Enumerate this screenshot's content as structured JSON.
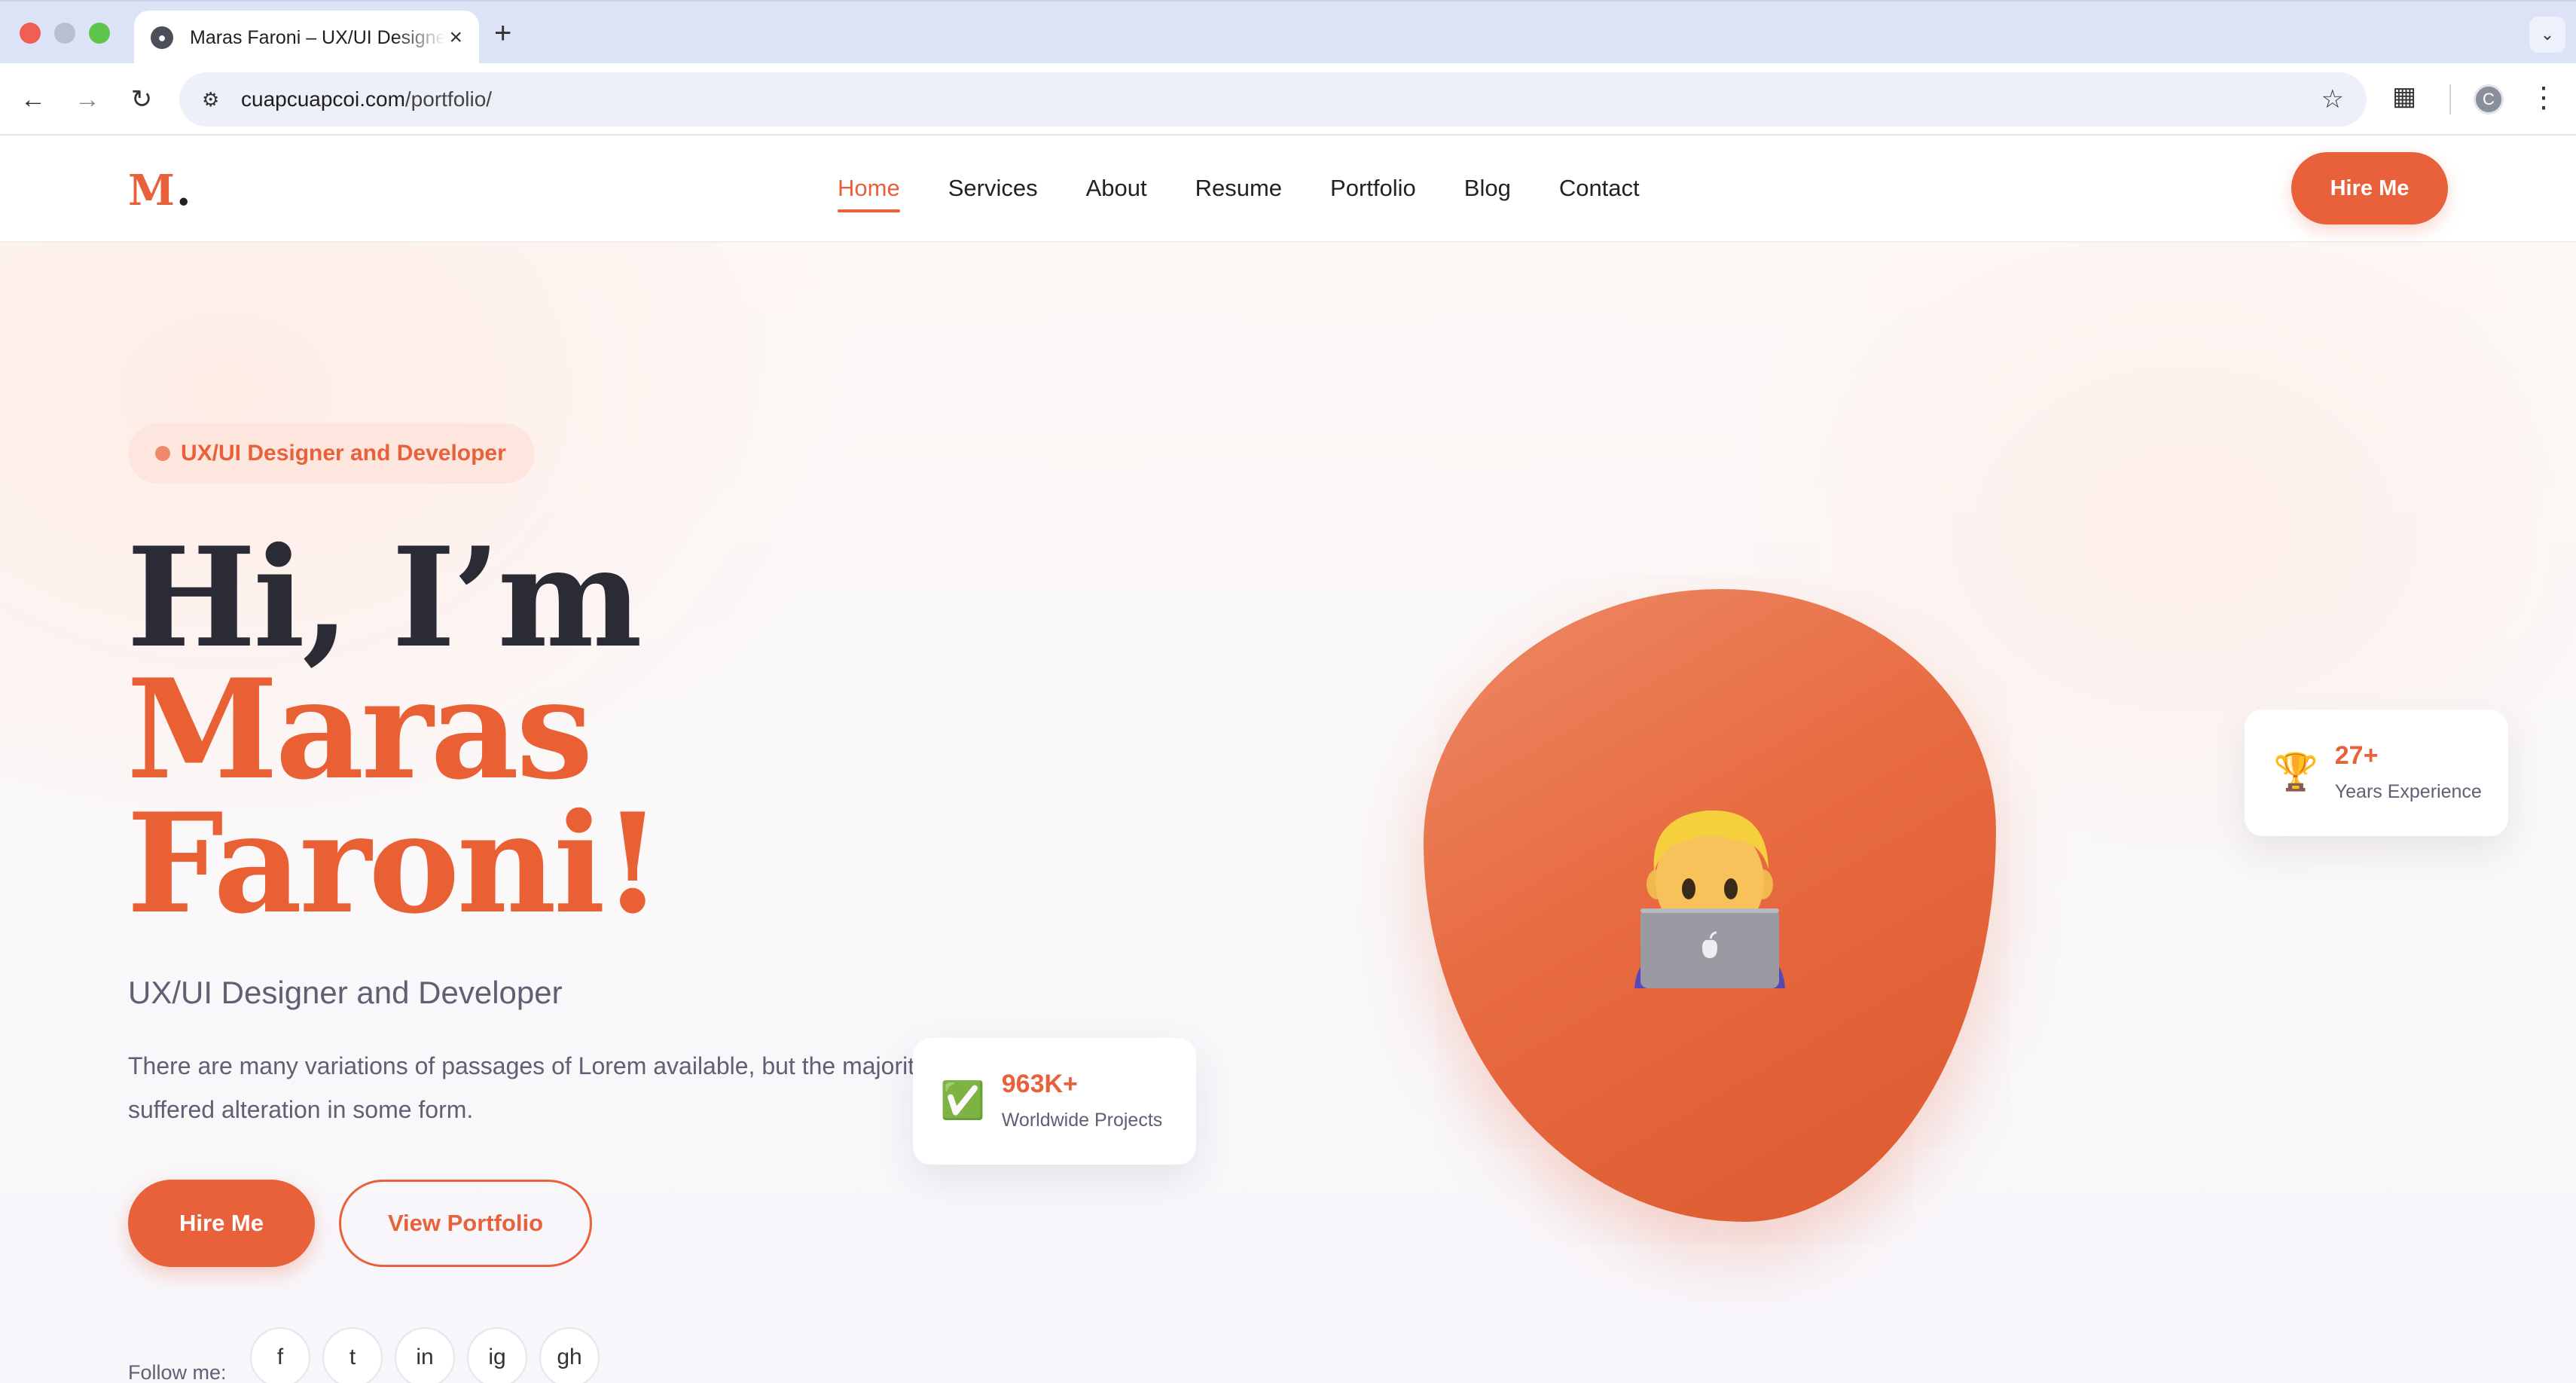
{
  "browser": {
    "tab_title": "Maras Faroni – UX/UI Designer",
    "url_host": "cuapcuapcoi.com",
    "url_path": "/portfolio/",
    "profile_initial": "C",
    "icons": [
      "close-icon",
      "plus-icon",
      "chevron-down-icon",
      "back-icon",
      "forward-icon",
      "reload-icon",
      "site-info-icon",
      "star-icon",
      "extensions-icon",
      "kebab-menu-icon"
    ]
  },
  "header": {
    "logo_letter": "M",
    "logo_dot": ".",
    "nav": [
      {
        "label": "Home",
        "active": true
      },
      {
        "label": "Services",
        "active": false
      },
      {
        "label": "About",
        "active": false
      },
      {
        "label": "Resume",
        "active": false
      },
      {
        "label": "Portfolio",
        "active": false
      },
      {
        "label": "Blog",
        "active": false
      },
      {
        "label": "Contact",
        "active": false
      }
    ],
    "cta": "Hire Me"
  },
  "hero": {
    "badge": "UX/UI Designer and Developer",
    "heading_line1": "Hi, I’m",
    "heading_line2": "Maras",
    "heading_line3": "Faroni!",
    "subtitle": "UX/UI Designer and Developer",
    "description": "There are many variations of passages of Lorem available, but the majority have suffered alteration in some form.",
    "primary_button": "Hire Me",
    "secondary_button": "View Portfolio",
    "follow_label": "Follow me:",
    "socials": [
      "f",
      "t",
      "in",
      "ig",
      "gh"
    ],
    "illustration": "man-technologist-emoji"
  },
  "stats": {
    "experience": {
      "value": "27+",
      "label": "Years Experience",
      "icon": "trophy-icon"
    },
    "projects": {
      "value": "963K+",
      "label": "Worldwide Projects",
      "icon": "check-mark-icon"
    }
  },
  "colors": {
    "accent": "#e8613a",
    "heading_dark": "#2b2b36",
    "muted_text": "#5e6173",
    "badge_bg": "#fde6dd"
  }
}
